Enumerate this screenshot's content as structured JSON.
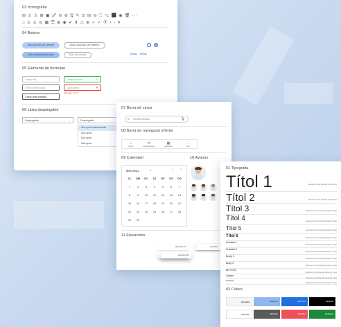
{
  "iconography": {
    "title": "03 Iconografia",
    "row1": "⊟ ♙ ♙ ⊞ ▣ 🖉 ⊘ ⊛ 🖫 ✎ ⊡ ⊟ ◎ ⛶ ⌥ ⬛ ◉ 🗑 ···",
    "row2": "⌂ ♙ ♙ ◎ ▦ ☰ ⊞ ◉ ✔ ⬇ ⚠ ⊕ ✓ ✓ ⦿ ‹ › ✕"
  },
  "buttons": {
    "title": "04 Botons",
    "primary_default": "Botó primari per defecte",
    "secondary_default": "Botó secundari per defecte",
    "primary_pressed": "Botó primari pressionat",
    "disabled": "Botó desactivat",
    "link1": "Enllaç",
    "link2": "Enllaç"
  },
  "form": {
    "title": "05 Elements de formulari",
    "text_field": "Camp text",
    "correct_field": "Camp correcte",
    "selected_field": "Camp seleccionat",
    "error_field": "Camp error",
    "error_message": "Missatge d'error",
    "input_field": "Camp amb entrada"
  },
  "dropdown": {
    "title": "06 Llista desplegable",
    "closed_label": "Desplegable",
    "open_label": "Desplegable",
    "options": [
      "Sub-opció seleccionada",
      "Sub-opció",
      "Sub-opció",
      "Sub-opció"
    ]
  },
  "search": {
    "title": "07 Barra de cerca",
    "placeholder": "Senseenasana"
  },
  "bottom_nav": {
    "title": "08 Barra de navegació inferior",
    "items": [
      "Home",
      "Comunicacions",
      "Calendario",
      "Més"
    ]
  },
  "calendar": {
    "title": "09 Calendari",
    "month": "Mes 2021",
    "weekdays": [
      "DL",
      "DM",
      "DC",
      "DJ",
      "DV",
      "DS",
      "DG"
    ],
    "days": [
      "1",
      "2",
      "3",
      "4",
      "5",
      "6",
      "7",
      "8",
      "9",
      "10",
      "11",
      "12",
      "13",
      "14",
      "15",
      "16",
      "17",
      "18",
      "19",
      "20",
      "21",
      "22",
      "23",
      "24",
      "25",
      "26",
      "27",
      "28",
      "29",
      "30"
    ]
  },
  "avatars": {
    "title": "10 Avatars"
  },
  "elevations": {
    "title": "11 Elevacions",
    "labels": [
      "elevació 01",
      "elevació 02",
      "elevació",
      "elevació 06",
      "elevació 08"
    ]
  },
  "typography": {
    "title": "01 Tipografia",
    "styles": [
      {
        "label": "Títol 1",
        "meta": "Helvetica Now Display Light 96px"
      },
      {
        "label": "Títol 2",
        "meta": "Helvetica Now Display Light 60px"
      },
      {
        "label": "Títol 3",
        "meta": "Helvetica Now Display Regular 48px"
      },
      {
        "label": "Títol 4",
        "meta": "Helvetica Now Display Regular 34px"
      },
      {
        "label": "Títol 5",
        "meta": "Helvetica Now Display Regular 24px"
      },
      {
        "label": "Títol 6",
        "meta": "Helvetica Now Display Medium 20px"
      },
      {
        "label": "Subtítol 1",
        "meta": "Helvetica Now Display Regular 16px"
      },
      {
        "label": "Subtítol 2",
        "meta": "Helvetica Now Display Medium 14px"
      },
      {
        "label": "Body 1",
        "meta": "Helvetica Now Display Regular 16px"
      },
      {
        "label": "Body 2",
        "meta": "Helvetica Now Display Regular 14px"
      },
      {
        "label": "BUTTON",
        "meta": "Helvetica Now Display Medium 14px"
      },
      {
        "label": "Caption",
        "meta": "Helvetica Now Display Regular 12px"
      },
      {
        "label": "Overline",
        "meta": "Helvetica Now Display Regular 10px"
      }
    ]
  },
  "colors": {
    "title": "02 Colors",
    "swatches": [
      {
        "hex": "#f5f5f5",
        "label": "#E0E0EE"
      },
      {
        "hex": "#8fb6ee",
        "label": "#A8C0F4"
      },
      {
        "hex": "#1f6fe0",
        "label": "#0077CC"
      },
      {
        "hex": "#000000",
        "label": "#000000"
      },
      {
        "hex": "#ffffff",
        "label": "#FFFFFF"
      },
      {
        "hex": "#5a5a5a",
        "label": "#5A5A5A"
      },
      {
        "hex": "#f0505a",
        "label": "#F0505A"
      },
      {
        "hex": "#1a8a3a",
        "label": "#1A8A3A"
      }
    ]
  }
}
